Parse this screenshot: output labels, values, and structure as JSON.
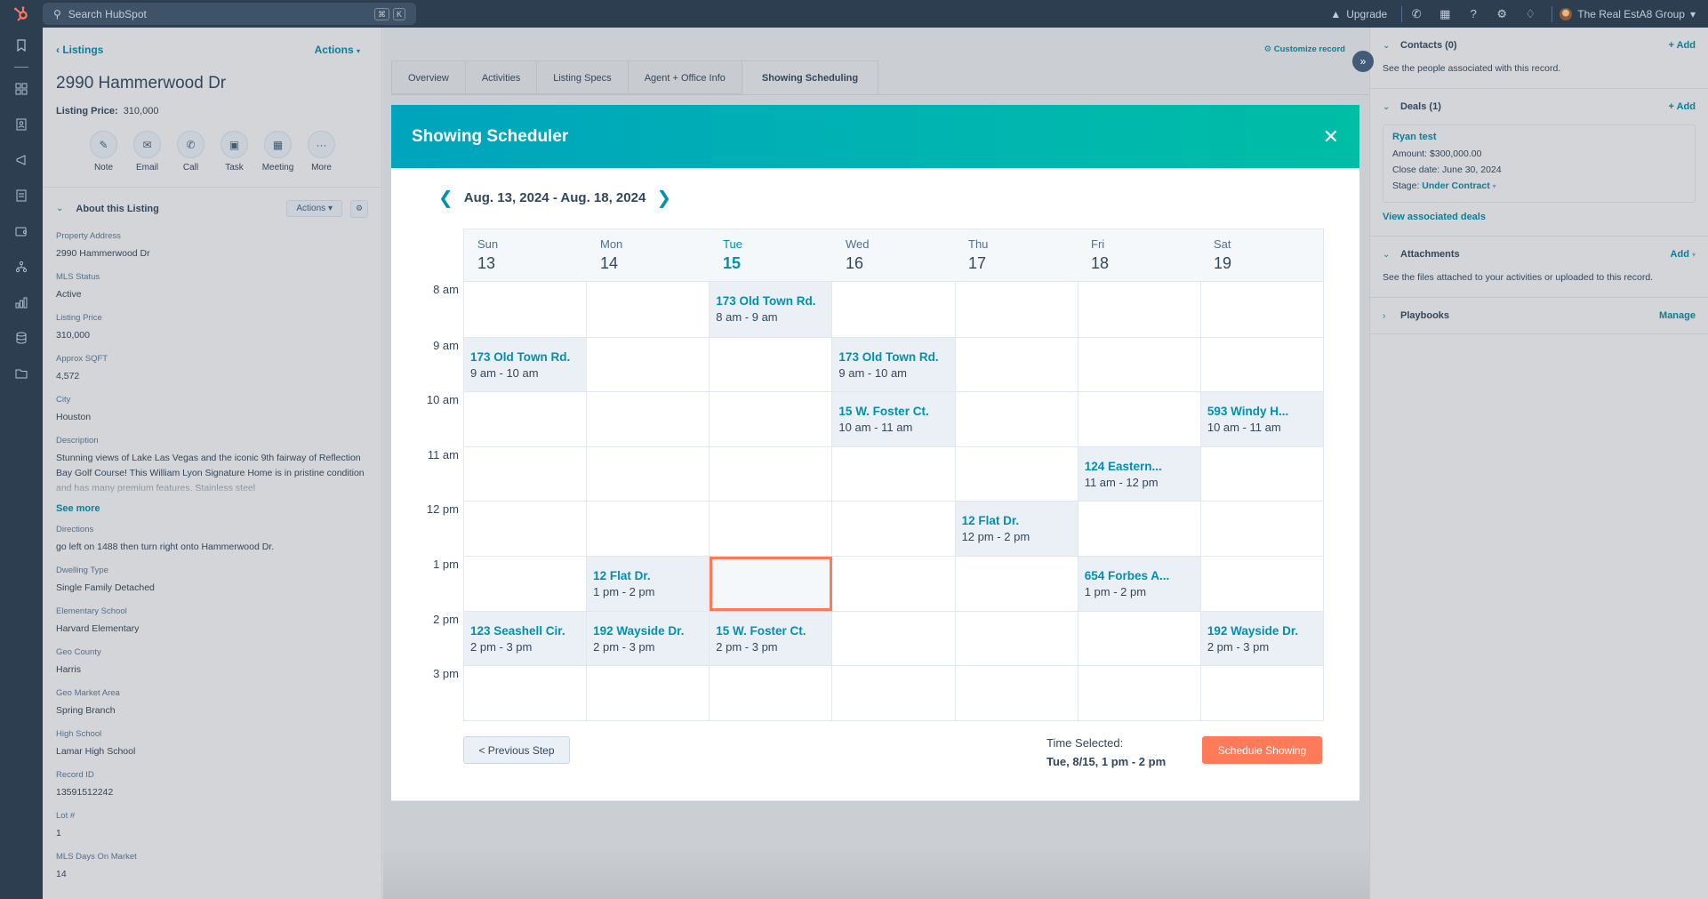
{
  "topbar": {
    "search_placeholder": "Search HubSpot",
    "shortcut_keys": [
      "⌘",
      "K"
    ],
    "upgrade_label": "Upgrade",
    "account_name": "The Real EstA8 Group"
  },
  "left_nav": {
    "icons": [
      "bookmark-icon",
      "apps-grid-icon",
      "contacts-icon",
      "marketing-megaphone-icon",
      "content-icon",
      "commerce-wallet-icon",
      "automation-icon",
      "reporting-icon",
      "data-management-icon",
      "library-folder-icon"
    ]
  },
  "record": {
    "breadcrumb": "Listings",
    "actions_label": "Actions",
    "title": "2990 Hammerwood Dr",
    "price_label": "Listing Price:",
    "price_value": "310,000",
    "quick_actions": [
      {
        "label": "Note",
        "icon": "note-icon"
      },
      {
        "label": "Email",
        "icon": "email-icon"
      },
      {
        "label": "Call",
        "icon": "call-icon"
      },
      {
        "label": "Task",
        "icon": "task-icon"
      },
      {
        "label": "Meeting",
        "icon": "meeting-icon"
      },
      {
        "label": "More",
        "icon": "more-icon"
      }
    ],
    "about_title": "About this Listing",
    "about_actions_label": "Actions",
    "properties": [
      {
        "label": "Property Address",
        "value": "2990 Hammerwood Dr"
      },
      {
        "label": "MLS Status",
        "value": "Active"
      },
      {
        "label": "Listing Price",
        "value": "310,000"
      },
      {
        "label": "Approx SQFT",
        "value": "4,572"
      },
      {
        "label": "City",
        "value": "Houston"
      },
      {
        "label": "Description",
        "value": "Stunning views of Lake Las Vegas and the iconic 9th fairway of Reflection Bay Golf Course! This William Lyon Signature Home is in pristine condition and has many premium features. Stainless steel"
      },
      {
        "label": "Directions",
        "value": "go left on 1488 then turn right onto Hammerwood Dr."
      },
      {
        "label": "Dwelling Type",
        "value": "Single Family Detached"
      },
      {
        "label": "Elementary School",
        "value": "Harvard Elementary"
      },
      {
        "label": "Geo County",
        "value": "Harris"
      },
      {
        "label": "Geo Market Area",
        "value": "Spring Branch"
      },
      {
        "label": "High School",
        "value": "Lamar High School"
      },
      {
        "label": "Record ID",
        "value": "13591512242"
      },
      {
        "label": "Lot #",
        "value": "1"
      },
      {
        "label": "MLS Days On Market",
        "value": "14"
      }
    ],
    "see_more_label": "See more"
  },
  "center": {
    "customize_label": "Customize record",
    "tabs": [
      {
        "label": "Overview",
        "active": false
      },
      {
        "label": "Activities",
        "active": false
      },
      {
        "label": "Listing Specs",
        "active": false
      },
      {
        "label": "Agent + Office Info",
        "active": false
      },
      {
        "label": "Showing Scheduling",
        "active": true
      }
    ]
  },
  "scheduler": {
    "title": "Showing Scheduler",
    "date_range": "Aug. 13, 2024 - Aug. 18, 2024",
    "days": [
      {
        "name": "Sun",
        "date": "13",
        "today": false
      },
      {
        "name": "Mon",
        "date": "14",
        "today": false
      },
      {
        "name": "Tue",
        "date": "15",
        "today": true
      },
      {
        "name": "Wed",
        "date": "16",
        "today": false
      },
      {
        "name": "Thu",
        "date": "17",
        "today": false
      },
      {
        "name": "Fri",
        "date": "18",
        "today": false
      },
      {
        "name": "Sat",
        "date": "19",
        "today": false
      }
    ],
    "hours": [
      "8 am",
      "9 am",
      "10 am",
      "11 am",
      "12 pm",
      "1 pm",
      "2 pm",
      "3 pm"
    ],
    "events": [
      {
        "day": 2,
        "hour": 0,
        "title": "173 Old Town Rd.",
        "time": "8 am - 9 am"
      },
      {
        "day": 0,
        "hour": 1,
        "title": "173 Old Town Rd.",
        "time": "9 am - 10 am"
      },
      {
        "day": 3,
        "hour": 1,
        "title": "173 Old Town Rd.",
        "time": "9 am - 10 am"
      },
      {
        "day": 3,
        "hour": 2,
        "title": "15 W. Foster Ct.",
        "time": "10 am - 11 am"
      },
      {
        "day": 6,
        "hour": 2,
        "title": "593 Windy H...",
        "time": "10 am - 11 am"
      },
      {
        "day": 5,
        "hour": 3,
        "title": "124 Eastern...",
        "time": "11 am - 12 pm"
      },
      {
        "day": 4,
        "hour": 4,
        "title": "12 Flat Dr.",
        "time": "12 pm - 2 pm"
      },
      {
        "day": 1,
        "hour": 5,
        "title": "12 Flat Dr.",
        "time": "1 pm - 2 pm"
      },
      {
        "day": 5,
        "hour": 5,
        "title": "654 Forbes A...",
        "time": "1 pm - 2 pm"
      },
      {
        "day": 0,
        "hour": 6,
        "title": "123  Seashell Cir.",
        "time": "2 pm - 3 pm"
      },
      {
        "day": 1,
        "hour": 6,
        "title": "192 Wayside Dr.",
        "time": "2 pm - 3 pm"
      },
      {
        "day": 2,
        "hour": 6,
        "title": "15 W. Foster Ct.",
        "time": "2 pm - 3 pm"
      },
      {
        "day": 6,
        "hour": 6,
        "title": "192 Wayside Dr.",
        "time": "2 pm - 3 pm"
      }
    ],
    "selected_slot": {
      "day": 2,
      "hour": 5
    },
    "previous_step_label": "< Previous Step",
    "time_selected_label": "Time Selected:",
    "time_selected_value": "Tue, 8/15, 1 pm - 2 pm",
    "schedule_button_label": "Schedule Showing",
    "accent_color": "#ff7a59",
    "header_gradient": [
      "#00a4bd",
      "#00bda5"
    ]
  },
  "sidebar_right": {
    "contacts": {
      "title": "Contacts (0)",
      "action": "+ Add",
      "description": "See the people associated with this record."
    },
    "deals": {
      "title": "Deals (1)",
      "action": "+ Add",
      "card": {
        "name": "Ryan test",
        "amount": "Amount: $300,000.00",
        "close_date": "Close date: June 30, 2024",
        "stage_label": "Stage:",
        "stage_value": "Under Contract"
      },
      "view_link": "View associated deals"
    },
    "attachments": {
      "title": "Attachments",
      "action": "Add",
      "description": "See the files attached to your activities or uploaded to this record."
    },
    "playbooks": {
      "title": "Playbooks",
      "action": "Manage"
    }
  }
}
